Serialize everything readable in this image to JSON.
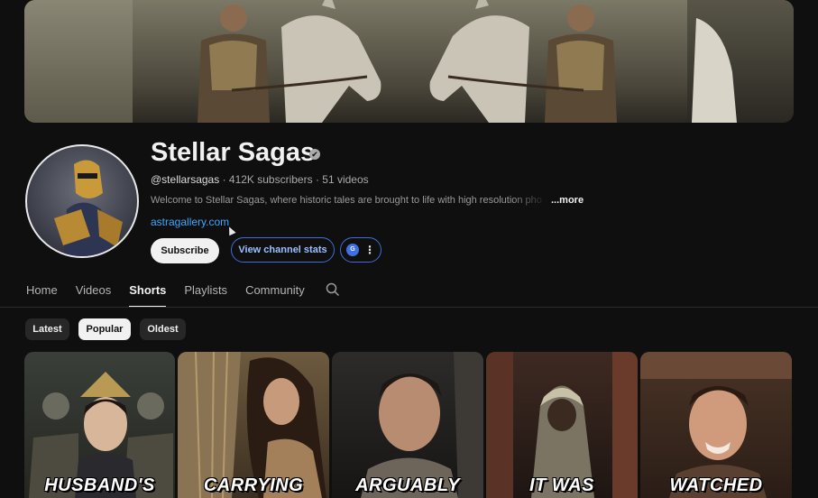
{
  "channel": {
    "name": "Stellar Sagas",
    "handle": "@stellarsagas",
    "stats": "· 412K subscribers · 51 videos",
    "description": "Welcome to Stellar Sagas, where historic tales are brought to life with high resolution pho",
    "more_label": "...more",
    "website": "astragallery.com",
    "verified_glyph": "✔"
  },
  "buttons": {
    "subscribe": "Subscribe",
    "view_stats": "View channel stats",
    "extra_glyph": "G",
    "dots_glyph": "⋮"
  },
  "tabs": [
    {
      "label": "Home",
      "active": false
    },
    {
      "label": "Videos",
      "active": false
    },
    {
      "label": "Shorts",
      "active": true
    },
    {
      "label": "Playlists",
      "active": false
    },
    {
      "label": "Community",
      "active": false
    }
  ],
  "chips": [
    {
      "label": "Latest",
      "selected": false
    },
    {
      "label": "Popular",
      "selected": true
    },
    {
      "label": "Oldest",
      "selected": false
    }
  ],
  "shorts": [
    {
      "caption": "HUSBAND'S"
    },
    {
      "caption": "CARRYING"
    },
    {
      "caption": "ARGUABLY"
    },
    {
      "caption": "IT WAS"
    },
    {
      "caption": "WATCHED"
    }
  ],
  "colors": {
    "background": "#0f0f0f",
    "link": "#3ea6ff",
    "accent_border": "#3c6fd8"
  }
}
